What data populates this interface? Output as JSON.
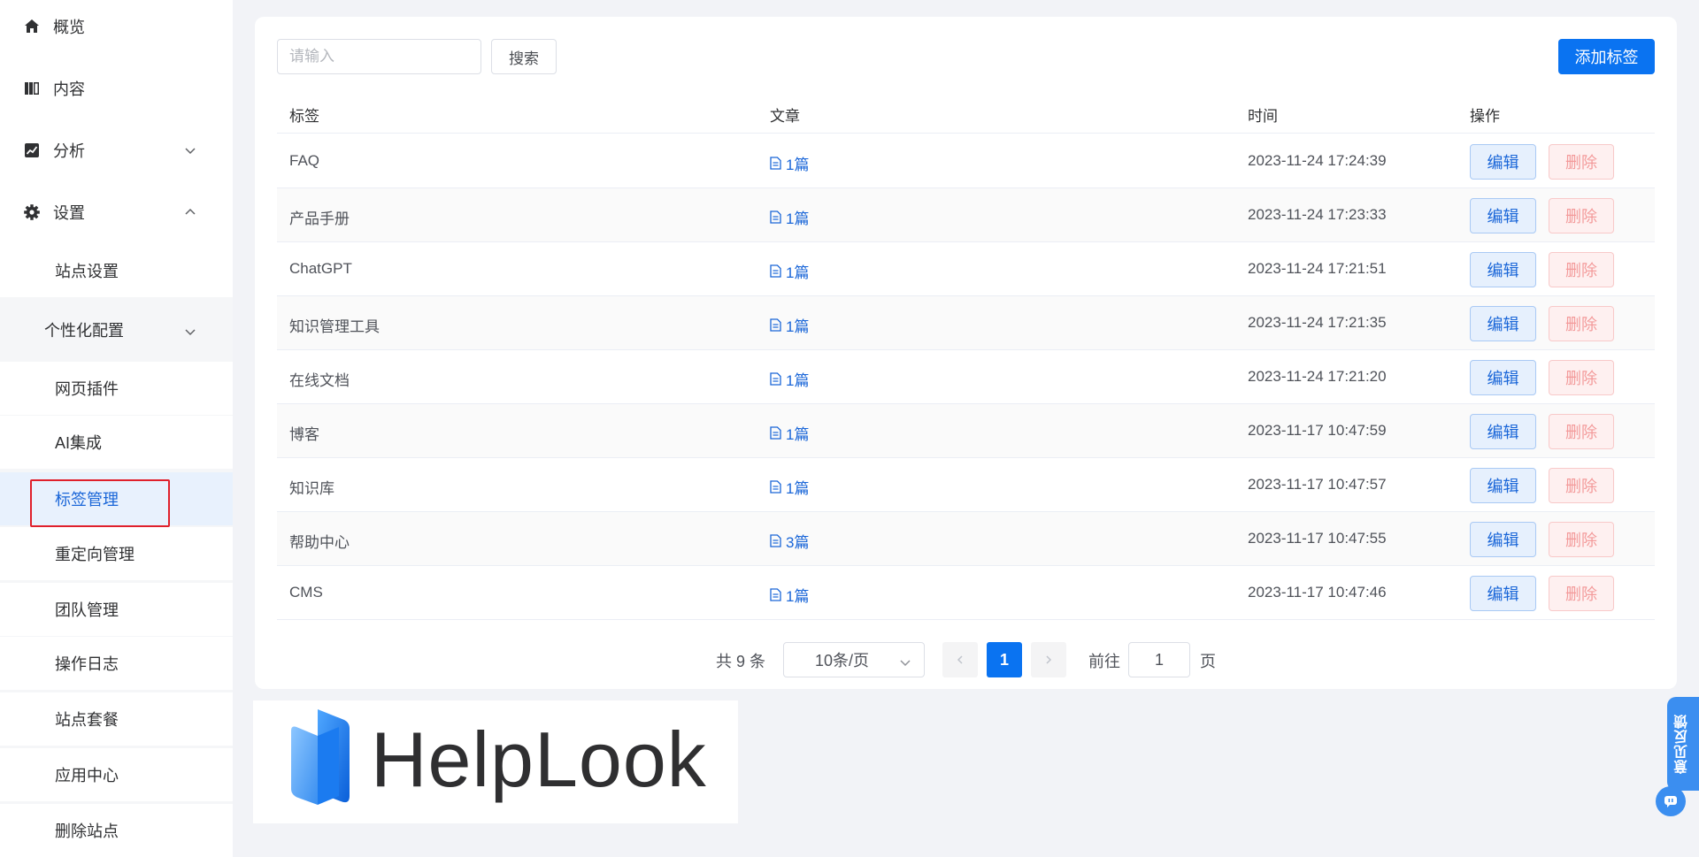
{
  "sidebar": {
    "items": [
      {
        "label": "概览",
        "icon": "home-icon"
      },
      {
        "label": "内容",
        "icon": "book-icon"
      },
      {
        "label": "分析",
        "icon": "chart-icon",
        "chevron": "chevron-down-icon"
      },
      {
        "label": "设置",
        "icon": "gear-icon",
        "chevron": "chevron-up-icon"
      }
    ],
    "settings_children": [
      {
        "label": "站点设置"
      },
      {
        "label": "个性化配置"
      },
      {
        "label": "网页插件"
      },
      {
        "label": "AI集成"
      },
      {
        "label": "标签管理",
        "active": true
      },
      {
        "label": "重定向管理"
      },
      {
        "label": "团队管理"
      },
      {
        "label": "操作日志"
      },
      {
        "label": "站点套餐"
      },
      {
        "label": "应用中心"
      },
      {
        "label": "删除站点"
      }
    ]
  },
  "toolbar": {
    "search_placeholder": "请输入",
    "search_value": "",
    "search_label": "搜索",
    "add_label": "添加标签"
  },
  "table": {
    "columns": [
      "标签",
      "文章",
      "时间",
      "操作"
    ],
    "edit_label": "编辑",
    "delete_label": "删除",
    "rows": [
      {
        "tag": "FAQ",
        "articles": "1篇",
        "time": "2023-11-24 17:24:39"
      },
      {
        "tag": "产品手册",
        "articles": "1篇",
        "time": "2023-11-24 17:23:33"
      },
      {
        "tag": "ChatGPT",
        "articles": "1篇",
        "time": "2023-11-24 17:21:51"
      },
      {
        "tag": "知识管理工具",
        "articles": "1篇",
        "time": "2023-11-24 17:21:35"
      },
      {
        "tag": "在线文档",
        "articles": "1篇",
        "time": "2023-11-24 17:21:20"
      },
      {
        "tag": "博客",
        "articles": "1篇",
        "time": "2023-11-17 10:47:59"
      },
      {
        "tag": "知识库",
        "articles": "1篇",
        "time": "2023-11-17 10:47:57"
      },
      {
        "tag": "帮助中心",
        "articles": "3篇",
        "time": "2023-11-17 10:47:55"
      },
      {
        "tag": "CMS",
        "articles": "1篇",
        "time": "2023-11-17 10:47:46"
      }
    ]
  },
  "pagination": {
    "total": "共 9 条",
    "page_size": "10条/页",
    "current_page": "1",
    "goto_label": "前往",
    "goto_value": "1",
    "page_suffix": "页"
  },
  "logo": {
    "text": "HelpLook",
    "color": "#2f2f31",
    "icon_color": "#1b7bf0"
  },
  "float_widget": {
    "label": "意见反馈"
  },
  "colors": {
    "accent": "#0a73f1",
    "link": "#1a66d8",
    "danger": "#f39a9a",
    "annotation": "#e0202b"
  }
}
